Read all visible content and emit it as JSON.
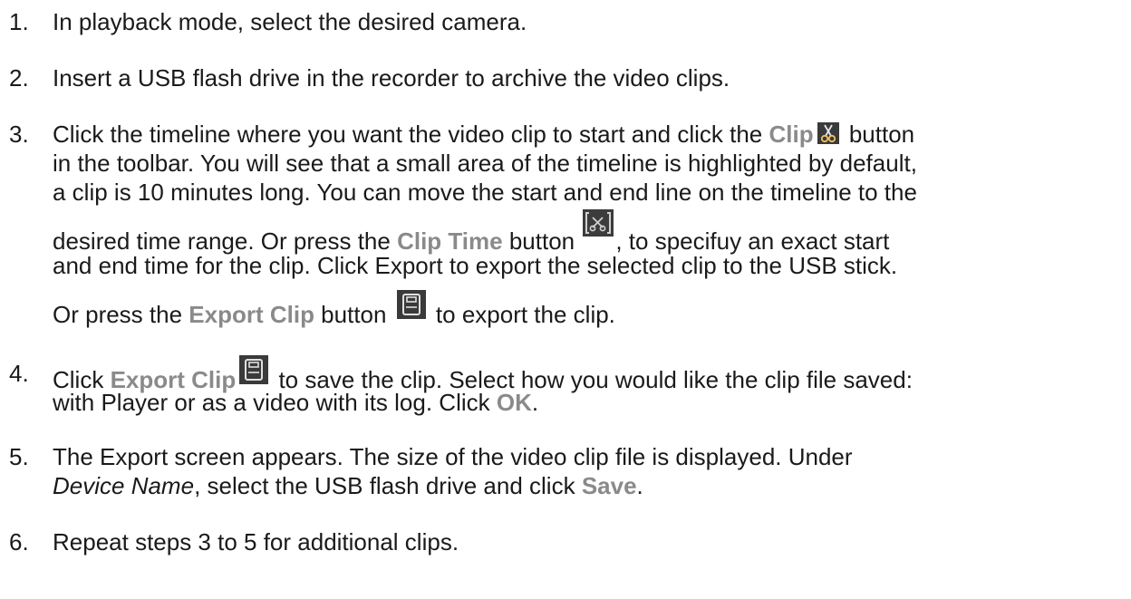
{
  "steps": [
    {
      "number": "1.",
      "line1": "In playback mode, select the desired camera."
    },
    {
      "number": "2.",
      "line1": "Insert a USB flash drive in the recorder to archive the video clips."
    },
    {
      "number": "3.",
      "l1_a": "Click the timeline where you want the video clip to start and click the ",
      "l1_b": "Clip",
      "l1_c": " button",
      "l2": "in the toolbar. You will see that a small area of the timeline is highlighted by default,",
      "l3": "a clip is 10 minutes long. You can move the start and end line on the timeline to the",
      "l4_a": "desired time range. Or press the ",
      "l4_b": "Clip Time",
      "l4_c": " button ",
      "l4_d": ", to specifuy an exact start",
      "l5": "and end time for the clip. Click Export to export the selected clip to the USB stick.",
      "l6_a": "Or press the ",
      "l6_b": "Export Clip",
      "l6_c": " button ",
      "l6_d": " to export the clip."
    },
    {
      "number": "4.",
      "l1_a": "Click ",
      "l1_b": "Export Clip",
      "l1_c": " to save the clip. Select how you would like the clip file saved:",
      "l2_a": "with Player or as a video with its log. Click ",
      "l2_b": "OK",
      "l2_c": "."
    },
    {
      "number": "5.",
      "l1": "The Export screen appears. The size of the video clip file is displayed. Under",
      "l2_a": "Device Name",
      "l2_b": ", select the USB flash drive and click ",
      "l2_c": "Save",
      "l2_d": "."
    },
    {
      "number": "6.",
      "line1": "Repeat steps 3 to 5 for additional clips."
    }
  ],
  "icons": {
    "clip": "scissors-icon",
    "clip_time": "clip-time-scissors-bracket-icon",
    "export_clip": "save-floppy-icon"
  }
}
